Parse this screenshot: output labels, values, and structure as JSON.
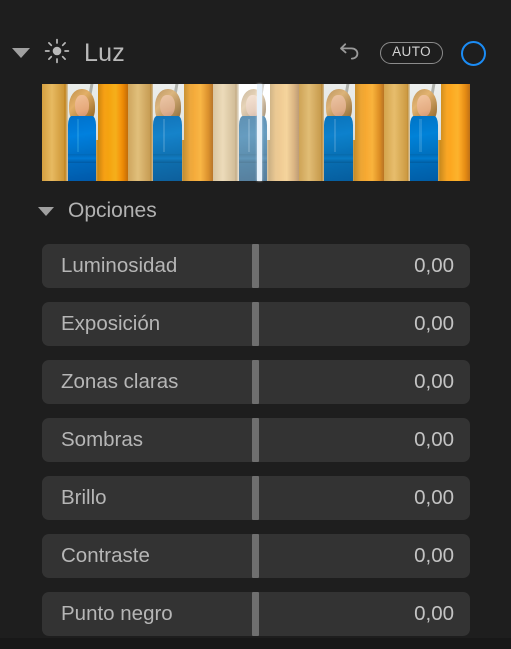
{
  "section": {
    "title": "Luz",
    "disclosure_icon": "triangle-down-icon",
    "section_icon": "sun-icon"
  },
  "header_controls": {
    "revert_icon": "revert-arrow-icon",
    "auto_label": "AUTO",
    "toggle_icon": "circle-ring-icon",
    "toggle_accent_color": "#1b8cf5"
  },
  "filmstrip": {
    "name": "light-variations-filmstrip",
    "thumbnail_count": 5,
    "selected_index": 3,
    "playhead_color": "#e8f2fb",
    "thumbnails": [
      {
        "alt": "woman-in-blue-dress-variation-1"
      },
      {
        "alt": "woman-in-blue-dress-variation-2"
      },
      {
        "alt": "woman-in-blue-dress-variation-3-selected"
      },
      {
        "alt": "woman-in-blue-dress-variation-4"
      },
      {
        "alt": "woman-in-blue-dress-variation-5"
      }
    ]
  },
  "options": {
    "label": "Opciones",
    "disclosure_icon": "triangle-down-icon"
  },
  "sliders": [
    {
      "label": "Luminosidad",
      "value": "0,00"
    },
    {
      "label": "Exposición",
      "value": "0,00"
    },
    {
      "label": "Zonas claras",
      "value": "0,00"
    },
    {
      "label": "Sombras",
      "value": "0,00"
    },
    {
      "label": "Brillo",
      "value": "0,00"
    },
    {
      "label": "Contraste",
      "value": "0,00"
    },
    {
      "label": "Punto negro",
      "value": "0,00"
    }
  ],
  "colors": {
    "panel_background": "#1e1e1e",
    "row_background": "#333333",
    "row_handle": "#6f6f6f",
    "label_text": "#b6b6b6",
    "value_text": "#c3c3c3"
  }
}
